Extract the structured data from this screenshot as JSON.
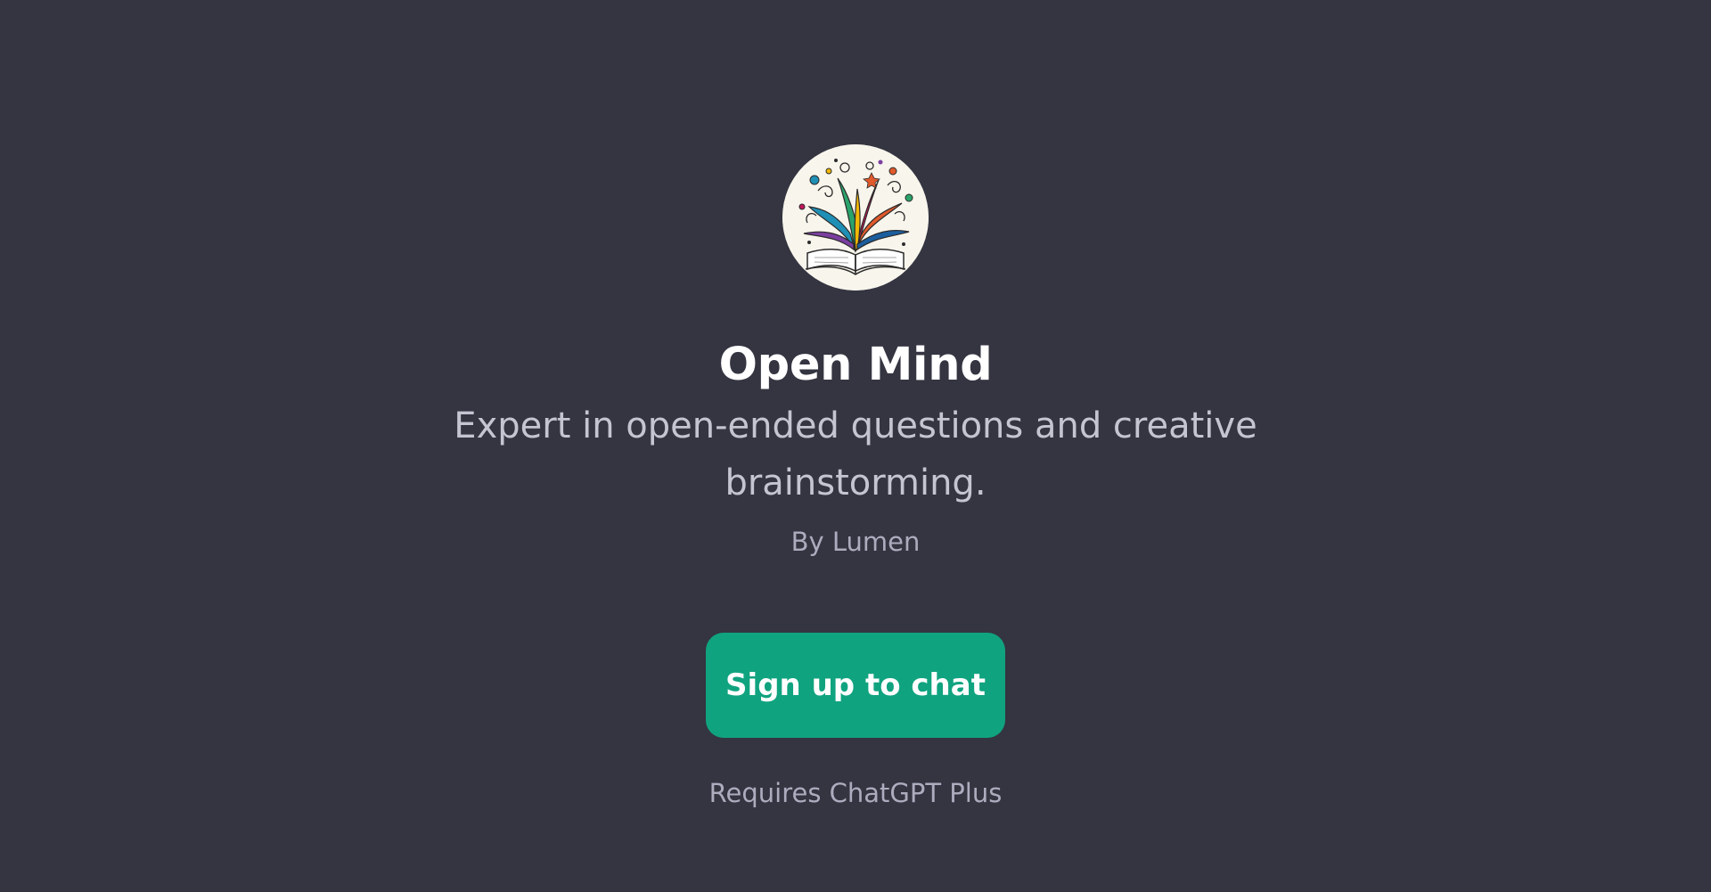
{
  "gpt": {
    "name": "Open Mind",
    "description": "Expert in open-ended questions and creative brainstorming.",
    "author": "By Lumen",
    "avatar_icon": "open-book-with-colorful-ideas-icon"
  },
  "actions": {
    "signup_label": "Sign up to chat"
  },
  "footer": {
    "requirement": "Requires ChatGPT Plus"
  },
  "colors": {
    "background": "#343541",
    "accent": "#10a37f",
    "title": "#ffffff",
    "description": "#c5c5d2",
    "muted": "#acacbe"
  }
}
